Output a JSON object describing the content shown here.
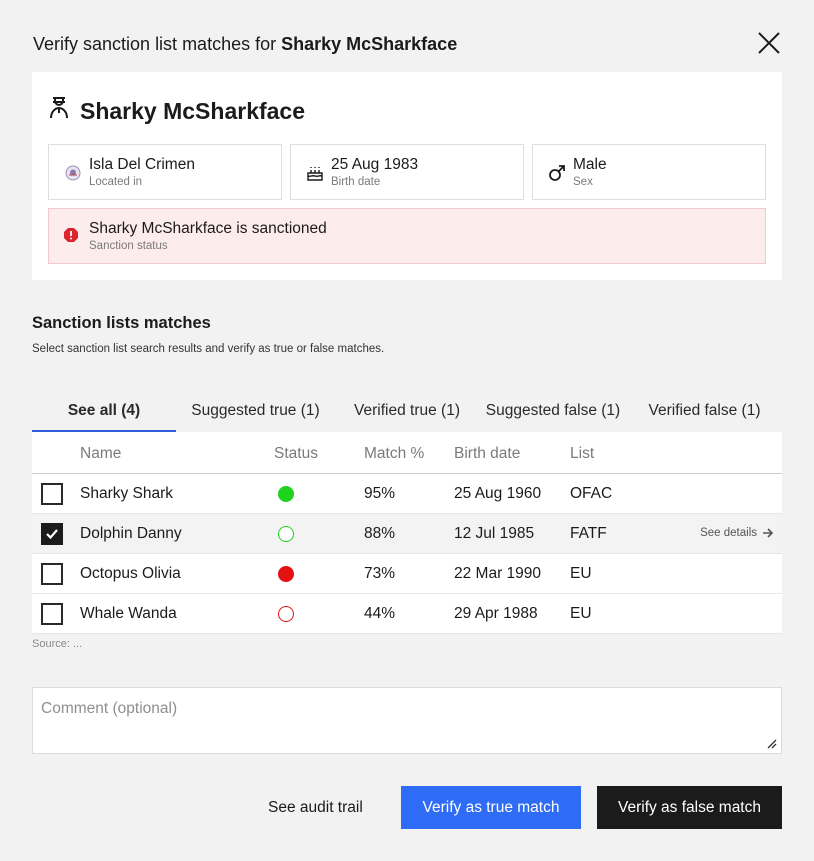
{
  "header": {
    "prefix": "Verify sanction list matches for ",
    "subject": "Sharky McSharkface",
    "close_icon": "close-icon"
  },
  "person": {
    "icon": "person-icon",
    "name": "Sharky McSharkface",
    "location": {
      "value": "Isla Del Crimen",
      "label": "Located in",
      "icon": "country-flag-icon"
    },
    "birth": {
      "value": "25 Aug 1983",
      "label": "Birth date",
      "icon": "birthday-cake-icon"
    },
    "sex": {
      "value": "Male",
      "label": "Sex",
      "icon": "male-symbol-icon"
    },
    "sanction": {
      "value": "Sharky McSharkface is sanctioned",
      "label": "Sanction status",
      "icon": "alert-icon",
      "color": "#e0242b"
    }
  },
  "section": {
    "title": "Sanction lists matches",
    "subtitle": "Select sanction list search results and verify as true or false matches."
  },
  "tabs": [
    {
      "label": "See all (4)",
      "active": true
    },
    {
      "label": "Suggested true (1)",
      "active": false
    },
    {
      "label": "Verified true (1)",
      "active": false
    },
    {
      "label": "Suggested false (1)",
      "active": false
    },
    {
      "label": "Verified false (1)",
      "active": false
    }
  ],
  "table": {
    "headers": {
      "name": "Name",
      "status": "Status",
      "match": "Match %",
      "birth": "Birth date",
      "list": "List"
    },
    "rows": [
      {
        "name": "Sharky Shark",
        "status": "suggested-true",
        "match": "95%",
        "birth": "25 Aug 1960",
        "list": "OFAC",
        "checked": false
      },
      {
        "name": "Dolphin Danny",
        "status": "verified-true",
        "match": "88%",
        "birth": "12 Jul 1985",
        "list": "FATF",
        "checked": true,
        "details": "See details"
      },
      {
        "name": "Octopus Olivia",
        "status": "suggested-false",
        "match": "73%",
        "birth": "22 Mar 1990",
        "list": "EU",
        "checked": false
      },
      {
        "name": "Whale Wanda",
        "status": "verified-false",
        "match": "44%",
        "birth": "29 Apr 1988",
        "list": "EU",
        "checked": false
      }
    ],
    "source": "Source: ..."
  },
  "comment": {
    "placeholder": "Comment (optional)",
    "value": ""
  },
  "footer": {
    "audit": "See audit trail",
    "true_btn": "Verify as true match",
    "false_btn": "Verify as false match"
  },
  "colors": {
    "accent": "#2e6cf6",
    "tab_underline": "#2e5fd8",
    "status_green": "#1ed21e",
    "status_red": "#e41111",
    "alert_bg": "#fdecec"
  }
}
